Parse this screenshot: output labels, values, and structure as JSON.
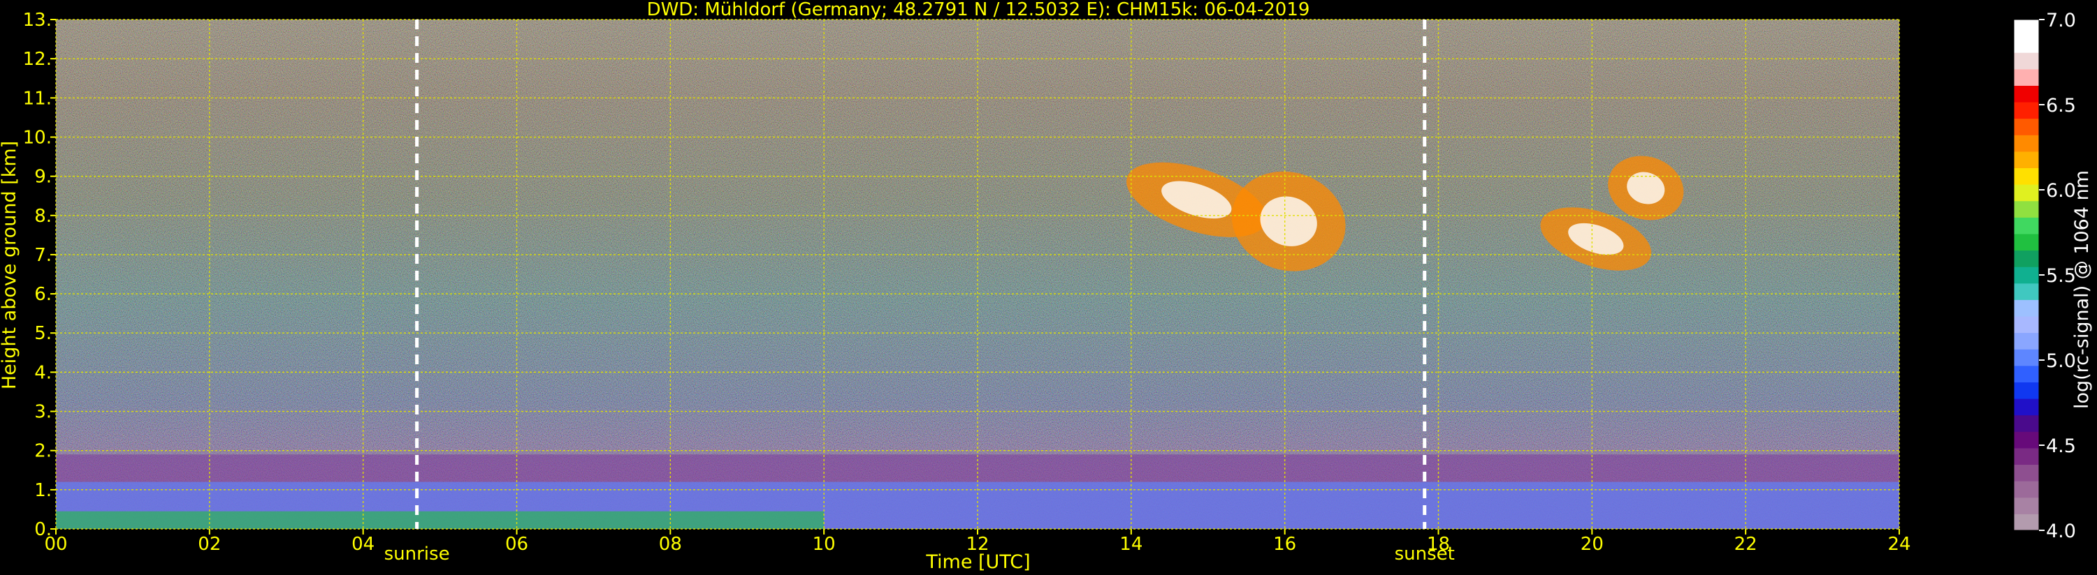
{
  "chart_data": {
    "type": "heatmap",
    "title": "DWD: Mühldorf (Germany; 48.2791 N / 12.5032 E):    CHM15k: 06-04-2019",
    "xlabel": "Time [UTC]",
    "ylabel": "Height above ground [km]",
    "xlim": [
      0,
      24
    ],
    "ylim": [
      0,
      13
    ],
    "x_ticks": [
      "00",
      "02",
      "04",
      "06",
      "08",
      "10",
      "12",
      "14",
      "16",
      "18",
      "20",
      "22",
      "24"
    ],
    "y_ticks": [
      "0.",
      "1.",
      "2.",
      "3.",
      "4.",
      "5.",
      "6.",
      "7.",
      "8.",
      "9.",
      "10.",
      "11.",
      "12.",
      "13."
    ],
    "grid": true,
    "events": [
      {
        "label": "sunrise",
        "time": 4.7
      },
      {
        "label": "sunset",
        "time": 17.82
      }
    ],
    "colorbar": {
      "label": "log(rc-signal) @ 1064 nm",
      "range": [
        4.0,
        7.0
      ],
      "ticks": [
        "4.0",
        "4.5",
        "5.0",
        "5.5",
        "6.0",
        "6.5",
        "7.0"
      ],
      "colors": [
        "#b39bae",
        "#a882a4",
        "#9c6a9a",
        "#8e4f90",
        "#7a2a84",
        "#670a7a",
        "#4a0a8c",
        "#2010c8",
        "#1038f0",
        "#3060ff",
        "#5e86ff",
        "#8aa6ff",
        "#a8b8ff",
        "#9dc0ff",
        "#40c8c0",
        "#10b090",
        "#10a060",
        "#20c040",
        "#40d860",
        "#90e040",
        "#e0f020",
        "#ffe000",
        "#ffb000",
        "#ff8a00",
        "#ff5a00",
        "#ff2000",
        "#f00000",
        "#ffb0b0",
        "#f0d8d8",
        "#ffffff",
        "#ffffff"
      ]
    },
    "regions": [
      {
        "kind": "boundary_layer_aerosol",
        "t_start": 0,
        "t_end": 24,
        "h_bottom": 0,
        "h_top": 1.9
      },
      {
        "kind": "cirrus",
        "t_start": 13.9,
        "t_end": 15.8,
        "h_bottom": 7.6,
        "h_top": 9.2
      },
      {
        "kind": "cirrus",
        "t_start": 15.3,
        "t_end": 16.8,
        "h_bottom": 6.6,
        "h_top": 9.1
      },
      {
        "kind": "cirrus",
        "t_start": 19.3,
        "t_end": 20.8,
        "h_bottom": 6.7,
        "h_top": 8.1
      },
      {
        "kind": "cirrus",
        "t_start": 20.2,
        "t_end": 21.2,
        "h_bottom": 7.9,
        "h_top": 9.5
      }
    ]
  }
}
